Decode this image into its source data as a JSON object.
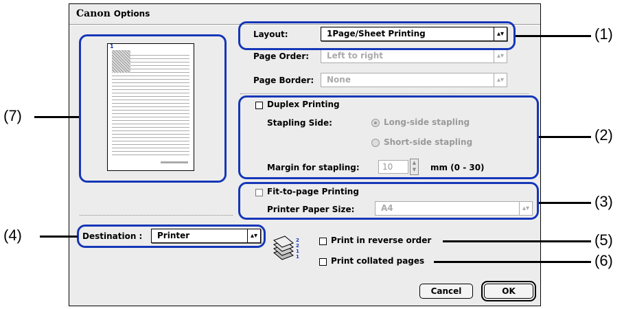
{
  "dialog": {
    "brand": "Canon",
    "title": "Options"
  },
  "layout": {
    "label": "Layout:",
    "value": "1Page/Sheet Printing"
  },
  "page_order": {
    "label": "Page Order:",
    "value": "Left to right"
  },
  "page_border": {
    "label": "Page Border:",
    "value": "None"
  },
  "duplex": {
    "label": "Duplex Printing",
    "checked": false,
    "stapling_side_label": "Stapling Side:",
    "long_side": "Long-side stapling",
    "short_side": "Short-side stapling",
    "margin_label": "Margin for stapling:",
    "margin_value": "10",
    "margin_range": "mm (0 - 30)"
  },
  "fit_to_page": {
    "label": "Fit-to-page Printing",
    "checked": false,
    "paper_size_label": "Printer Paper Size:",
    "paper_size_value": "A4"
  },
  "destination": {
    "label": "Destination :",
    "value": "Printer"
  },
  "reverse_order": {
    "label": "Print in reverse order",
    "checked": false
  },
  "collated": {
    "label": "Print collated pages",
    "checked": false
  },
  "preview": {
    "page_number": "1"
  },
  "buttons": {
    "cancel": "Cancel",
    "ok": "OK"
  },
  "callouts": {
    "c1": "(1)",
    "c2": "(2)",
    "c3": "(3)",
    "c4": "(4)",
    "c5": "(5)",
    "c6": "(6)",
    "c7": "(7)"
  },
  "colors": {
    "highlight": "#1536b8",
    "dialog_bg": "#ececec"
  }
}
